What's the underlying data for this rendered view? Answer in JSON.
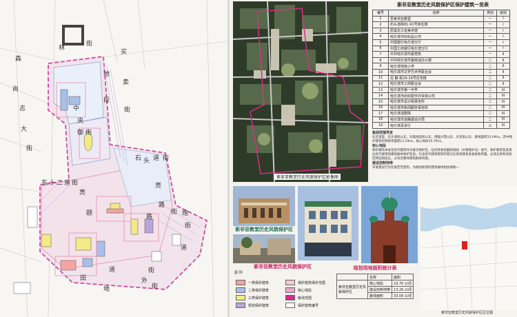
{
  "left_map": {
    "streets": [
      "森",
      "林",
      "街",
      "买",
      "卖",
      "地",
      "段",
      "街",
      "尚",
      "志",
      "大",
      "街",
      "中",
      "央",
      "御",
      "街",
      "石",
      "头",
      "道",
      "街",
      "东",
      "十",
      "二",
      "道",
      "街",
      "亮",
      "亮",
      "颐",
      "路",
      "街",
      "炮",
      "路",
      "街",
      "道",
      "田",
      "地",
      "外",
      "街",
      "道",
      "街"
    ]
  },
  "aerial": {
    "caption": "索非亚教堂历史风貌保护区影像图"
  },
  "table": {
    "title": "索非亚教堂历史风貌保护区保护建筑一览表",
    "headers": [
      "编号",
      "名称",
      "类别",
      "级别"
    ],
    "rows": [
      [
        "1",
        "圣索非亚教堂",
        "一",
        "I"
      ],
      [
        "2",
        "石头道街81-91号商住楼",
        "一",
        "I"
      ],
      [
        "3",
        "原黑龙江省美术馆",
        "一",
        "I"
      ],
      [
        "4",
        "哈尔滨市纺织品公司",
        "一",
        "I"
      ],
      [
        "5",
        "中国银行哈尔滨分行",
        "一",
        "I"
      ],
      [
        "6",
        "中国工商银行哈尔滨分行",
        "一",
        "I"
      ],
      [
        "7",
        "中共哈尔滨市委党校",
        "一",
        "II"
      ],
      [
        "8",
        "中共哈尔滨市委统战办公楼",
        "二",
        "II"
      ],
      [
        "9",
        "哈尔滨地铁小学",
        "二",
        "II"
      ],
      [
        "10",
        "哈尔滨市文学艺术界联合会",
        "二",
        "II"
      ],
      [
        "11",
        "兆 麟 街29-33号住宅楼",
        "二",
        "II"
      ],
      [
        "12",
        "哈尔滨市工商联合会",
        "二",
        "II"
      ],
      [
        "13",
        "哈尔滨市第一中学",
        "二",
        "III"
      ],
      [
        "14",
        "哈尔滨市纺织配件外贸易公司",
        "二",
        "III"
      ],
      [
        "15",
        "哈尔滨市设计院事务所",
        "二",
        "III"
      ],
      [
        "16",
        "哈尔滨市新闻服务事务所",
        "二",
        "III"
      ],
      [
        "17",
        "哈尔滨话剧院",
        "二",
        "III"
      ],
      [
        "18",
        "哈尔滨市道路建设分局",
        "二",
        "III"
      ],
      [
        "19",
        "哈尔滨百货行",
        "三",
        "III"
      ]
    ]
  },
  "notes": {
    "h1": "紫线范围界定",
    "p1": "北至道里、石头道街以北，东临地段街以东，南临大营以东、买卖街以东、紫线面积33.09ha，其中保护建筑控制地带面积13.29ha，核心地段19.70ha。",
    "h2": "核心地段",
    "p2": "保护建筑本身及近代建筑作为重点保护区，任何改善及翻新规划（文物保护法）进行，保护建筑及其周边近代建筑和建筑群体保护区段。包含近代建筑物等内容与历史街巷及各类质性界面，必须与原有的街区特征相适应，以符合整体建筑群体风貌。",
    "h3": "建设控制地带",
    "p3": "开发建设行为在规定范围内，为规划新建的建筑群体相协调统一"
  },
  "photos_title": "索非亚教堂历史风貌保护区",
  "legend": {
    "title": "索非亚教堂历史风貌保护区",
    "sub": "图 例",
    "items": [
      {
        "label": "一类保护建筑",
        "color": "#f4a3a3"
      },
      {
        "label": "二类保护建筑",
        "color": "#a9bfe8"
      },
      {
        "label": "三类保护建筑",
        "color": "#f3ea87"
      },
      {
        "label": "规划保护建筑",
        "color": "#b9a5d9"
      },
      {
        "label": "保护建筑保护范围",
        "color": "#f7c9d6"
      },
      {
        "label": "核心地段",
        "color": "#e9a8c8"
      },
      {
        "label": "紫线范围",
        "color": "#d02f8f"
      },
      {
        "label": "保护建筑编号",
        "color": "#ffffff"
      }
    ]
  },
  "areas": {
    "title": "规划用地面积统计表",
    "rows": [
      [
        "索非亚教堂历史风貌保护区",
        "核心地段",
        "19.70 公顷"
      ],
      [
        "",
        "建设控制地带",
        "13.29 公顷"
      ],
      [
        "",
        "紫线面积",
        "33.09 公顷"
      ]
    ],
    "col_headers": [
      "",
      "名称",
      "面积"
    ]
  },
  "loc_caption": "索非亚教堂历史风貌保护区区位图"
}
